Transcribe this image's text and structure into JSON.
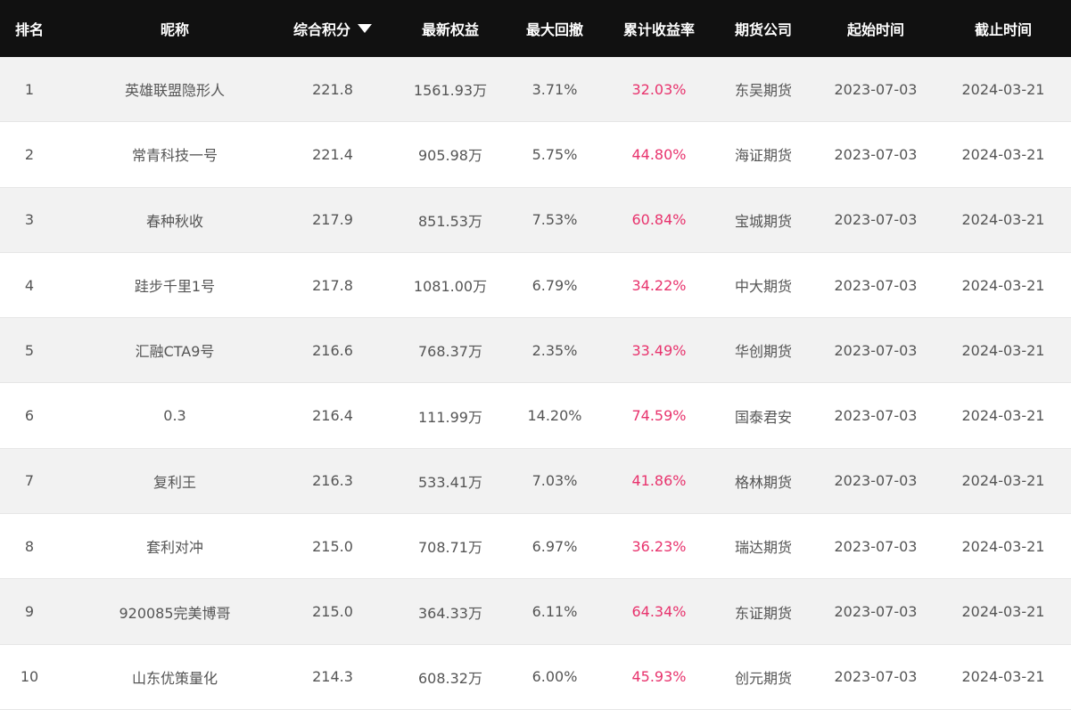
{
  "colors": {
    "header_bg": "#111111",
    "header_text": "#ffffff",
    "row_odd_bg": "#f2f2f2",
    "row_even_bg": "#ffffff",
    "body_text": "#555555",
    "return_text": "#e8336d"
  },
  "table": {
    "headers": {
      "rank": "排名",
      "nickname": "昵称",
      "score": "综合积分",
      "score_sort_icon": "caret-down-icon",
      "equity": "最新权益",
      "drawdown": "最大回撤",
      "return": "累计收益率",
      "company": "期货公司",
      "start": "起始时间",
      "end": "截止时间"
    },
    "rows": [
      {
        "rank": "1",
        "nickname": "英雄联盟隐形人",
        "score": "221.8",
        "equity": "1561.93万",
        "drawdown": "3.71%",
        "return": "32.03%",
        "company": "东吴期货",
        "start": "2023-07-03",
        "end": "2024-03-21"
      },
      {
        "rank": "2",
        "nickname": "常青科技一号",
        "score": "221.4",
        "equity": "905.98万",
        "drawdown": "5.75%",
        "return": "44.80%",
        "company": "海证期货",
        "start": "2023-07-03",
        "end": "2024-03-21"
      },
      {
        "rank": "3",
        "nickname": "春种秋收",
        "score": "217.9",
        "equity": "851.53万",
        "drawdown": "7.53%",
        "return": "60.84%",
        "company": "宝城期货",
        "start": "2023-07-03",
        "end": "2024-03-21"
      },
      {
        "rank": "4",
        "nickname": "跬步千里1号",
        "score": "217.8",
        "equity": "1081.00万",
        "drawdown": "6.79%",
        "return": "34.22%",
        "company": "中大期货",
        "start": "2023-07-03",
        "end": "2024-03-21"
      },
      {
        "rank": "5",
        "nickname": "汇融CTA9号",
        "score": "216.6",
        "equity": "768.37万",
        "drawdown": "2.35%",
        "return": "33.49%",
        "company": "华创期货",
        "start": "2023-07-03",
        "end": "2024-03-21"
      },
      {
        "rank": "6",
        "nickname": "0.3",
        "score": "216.4",
        "equity": "111.99万",
        "drawdown": "14.20%",
        "return": "74.59%",
        "company": "国泰君安",
        "start": "2023-07-03",
        "end": "2024-03-21"
      },
      {
        "rank": "7",
        "nickname": "复利王",
        "score": "216.3",
        "equity": "533.41万",
        "drawdown": "7.03%",
        "return": "41.86%",
        "company": "格林期货",
        "start": "2023-07-03",
        "end": "2024-03-21"
      },
      {
        "rank": "8",
        "nickname": "套利对冲",
        "score": "215.0",
        "equity": "708.71万",
        "drawdown": "6.97%",
        "return": "36.23%",
        "company": "瑞达期货",
        "start": "2023-07-03",
        "end": "2024-03-21"
      },
      {
        "rank": "9",
        "nickname": "920085完美博哥",
        "score": "215.0",
        "equity": "364.33万",
        "drawdown": "6.11%",
        "return": "64.34%",
        "company": "东证期货",
        "start": "2023-07-03",
        "end": "2024-03-21"
      },
      {
        "rank": "10",
        "nickname": "山东优策量化",
        "score": "214.3",
        "equity": "608.32万",
        "drawdown": "6.00%",
        "return": "45.93%",
        "company": "创元期货",
        "start": "2023-07-03",
        "end": "2024-03-21"
      }
    ]
  }
}
